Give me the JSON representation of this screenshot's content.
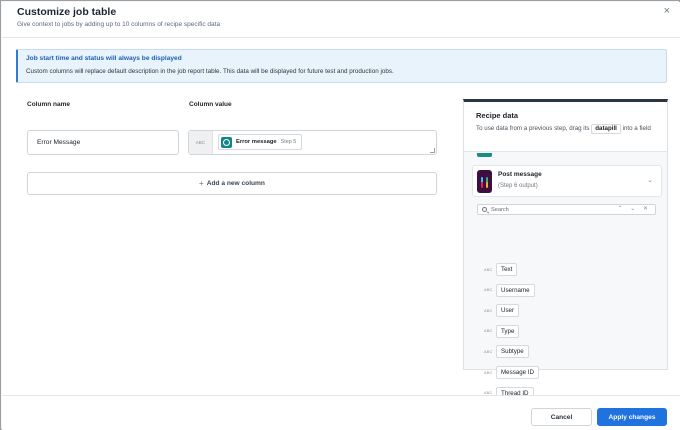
{
  "modal": {
    "title": "Customize job table",
    "subtitle": "Give context to jobs by adding up to 10 columns of recipe specific data",
    "close_label": "×"
  },
  "banner": {
    "title": "Job start time and status will always be displayed",
    "text": "Custom columns will replace default description in the job report table. This data will be displayed for future test and production jobs."
  },
  "columns": {
    "name_header": "Column name",
    "value_header": "Column value",
    "rows": [
      {
        "name": "Error Message",
        "value_type": "ABC",
        "pill_label": "Error message",
        "pill_step": "Step 5"
      }
    ],
    "add_label": "Add a new column",
    "add_icon": "+"
  },
  "recipe_data": {
    "title": "Recipe data",
    "desc_before": "To use data from a previous step, drag its ",
    "desc_tag": "datapill",
    "desc_after": " into a field",
    "step": {
      "title": "Post message",
      "subtitle": "(Step 6 output)",
      "icon": "slack-icon"
    },
    "search_placeholder": "Search",
    "search_controls": "⌃ ⌄ ✕",
    "field_type": "ABC",
    "fields": [
      "Text",
      "Username",
      "User",
      "Type",
      "Subtype",
      "Message ID",
      "Thread ID"
    ]
  },
  "footer": {
    "cancel_label": "Cancel",
    "apply_label": "Apply changes"
  },
  "colors": {
    "primary": "#1f72e0",
    "banner_accent": "#2f7bd6",
    "pill_icon": "#11878a",
    "slack": "#3f0e40"
  }
}
